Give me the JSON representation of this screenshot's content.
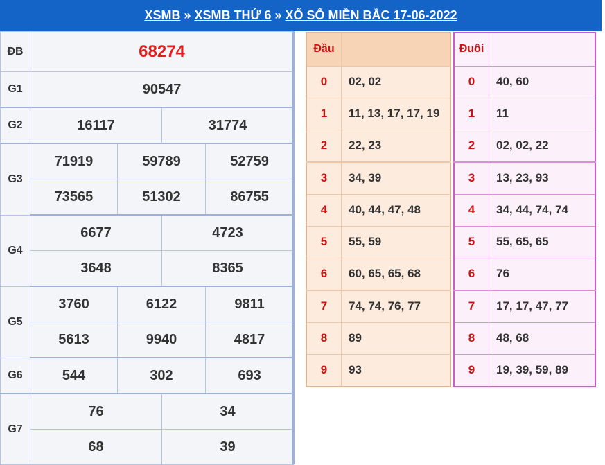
{
  "header": {
    "crumb1": "XSMB",
    "crumb2": "XSMB THỨ 6",
    "crumb3": "XỔ SỐ MIỀN BẮC 17-06-2022",
    "separator": "»"
  },
  "prizes": {
    "db": {
      "label": "ĐB",
      "values": [
        "68274"
      ]
    },
    "g1": {
      "label": "G1",
      "values": [
        "90547"
      ]
    },
    "g2": {
      "label": "G2",
      "values": [
        "16117",
        "31774"
      ]
    },
    "g3": {
      "label": "G3",
      "values": [
        "71919",
        "59789",
        "52759",
        "73565",
        "51302",
        "86755"
      ]
    },
    "g4": {
      "label": "G4",
      "values": [
        "6677",
        "4723",
        "3648",
        "8365"
      ]
    },
    "g5": {
      "label": "G5",
      "values": [
        "3760",
        "6122",
        "9811",
        "5613",
        "9940",
        "4817"
      ]
    },
    "g6": {
      "label": "G6",
      "values": [
        "544",
        "302",
        "693"
      ]
    },
    "g7": {
      "label": "G7",
      "values": [
        "76",
        "34",
        "68",
        "39"
      ]
    }
  },
  "dau": {
    "title": "Đầu",
    "rows": [
      {
        "key": "0",
        "val": "02, 02"
      },
      {
        "key": "1",
        "val": "11, 13, 17, 17, 19"
      },
      {
        "key": "2",
        "val": "22, 23"
      },
      {
        "key": "3",
        "val": "34, 39"
      },
      {
        "key": "4",
        "val": "40, 44, 47, 48"
      },
      {
        "key": "5",
        "val": "55, 59"
      },
      {
        "key": "6",
        "val": "60, 65, 65, 68"
      },
      {
        "key": "7",
        "val": "74, 74, 76, 77"
      },
      {
        "key": "8",
        "val": "89"
      },
      {
        "key": "9",
        "val": "93"
      }
    ]
  },
  "duoi": {
    "title": "Đuôi",
    "rows": [
      {
        "key": "0",
        "val": "40, 60"
      },
      {
        "key": "1",
        "val": "11"
      },
      {
        "key": "2",
        "val": "02, 02, 22"
      },
      {
        "key": "3",
        "val": "13, 23, 93"
      },
      {
        "key": "4",
        "val": "34, 44, 74, 74"
      },
      {
        "key": "5",
        "val": "55, 65, 65"
      },
      {
        "key": "6",
        "val": "76"
      },
      {
        "key": "7",
        "val": "17, 17, 47, 77"
      },
      {
        "key": "8",
        "val": "48, 68"
      },
      {
        "key": "9",
        "val": "19, 39, 59, 89"
      }
    ]
  },
  "colors": {
    "header_bg": "#1464c8",
    "special_prize": "#e02020",
    "dau_bg": "#fdebde",
    "duoi_border": "#d058c8"
  }
}
